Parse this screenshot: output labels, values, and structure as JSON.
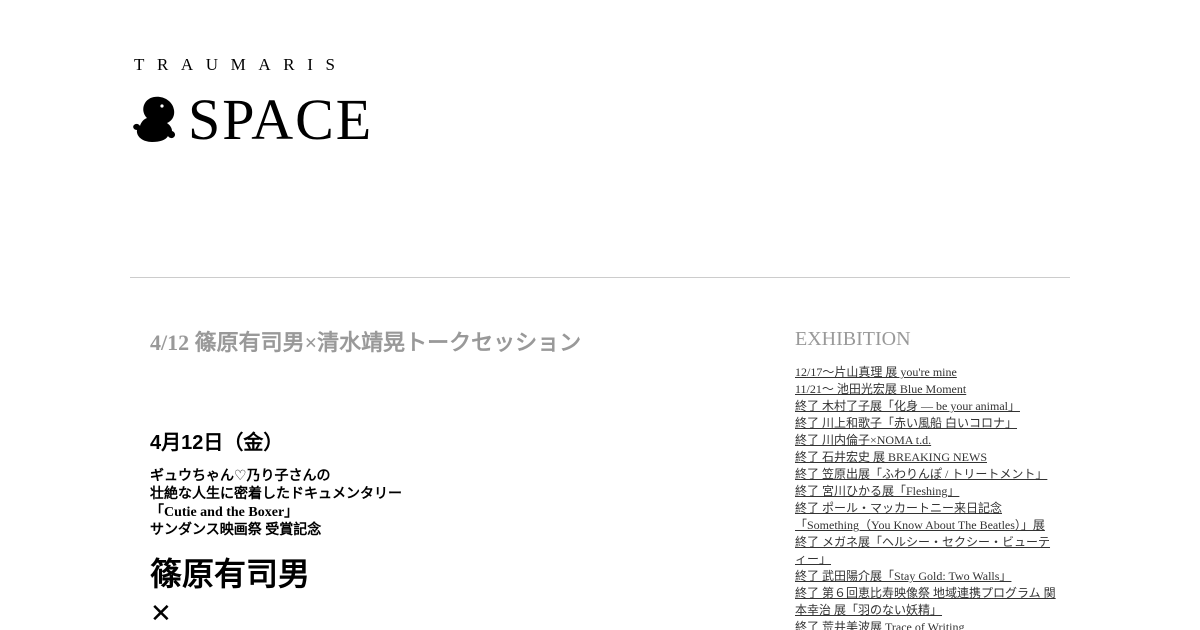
{
  "header": {
    "brand_small": "TRAUMARIS",
    "brand_big": "SPACE",
    "logo_icon": "squirrel-logo-icon"
  },
  "post": {
    "title": "4/12 篠原有司男×清水靖晃トークセッション",
    "date": "4月12日（金）",
    "intro_lines": [
      "ギュウちゃん♡乃り子さんの",
      "壮絶な人生に密着したドキュメンタリー",
      "「Cutie and the Boxer」",
      "サンダンス映画祭 受賞記念"
    ],
    "speaker": "篠原有司男",
    "cross": "✕"
  },
  "sidebar": {
    "heading": "EXHIBITION",
    "items": [
      "12/17〜片山真理 展 you're mine",
      "11/21〜 池田光宏展 Blue Moment",
      "終了 木村了子展「化身 — be your animal」",
      "終了 川上和歌子「赤い風船 白いコロナ」",
      "終了 川内倫子×NOMA t.d.",
      "終了 石井宏史 展 BREAKING NEWS",
      "終了 笠原出展「ふわりんぽ / トリートメント」",
      "終了 宮川ひかる展「Fleshing」",
      "終了 ポール・マッカートニー来日記念「Something（You Know About The Beatles）」展",
      "終了 メガネ展「ヘルシー・セクシー・ビューティー」",
      "終了 武田陽介展「Stay Gold: Two Walls」",
      "終了 第６回恵比寿映像祭 地域連携プログラム 関本幸治 展「羽のない妖精」",
      "終了 荒井美波展 Trace of Writing"
    ]
  },
  "colors": {
    "muted_gray": "#999999",
    "link": "#333333",
    "divider": "#cccccc"
  }
}
